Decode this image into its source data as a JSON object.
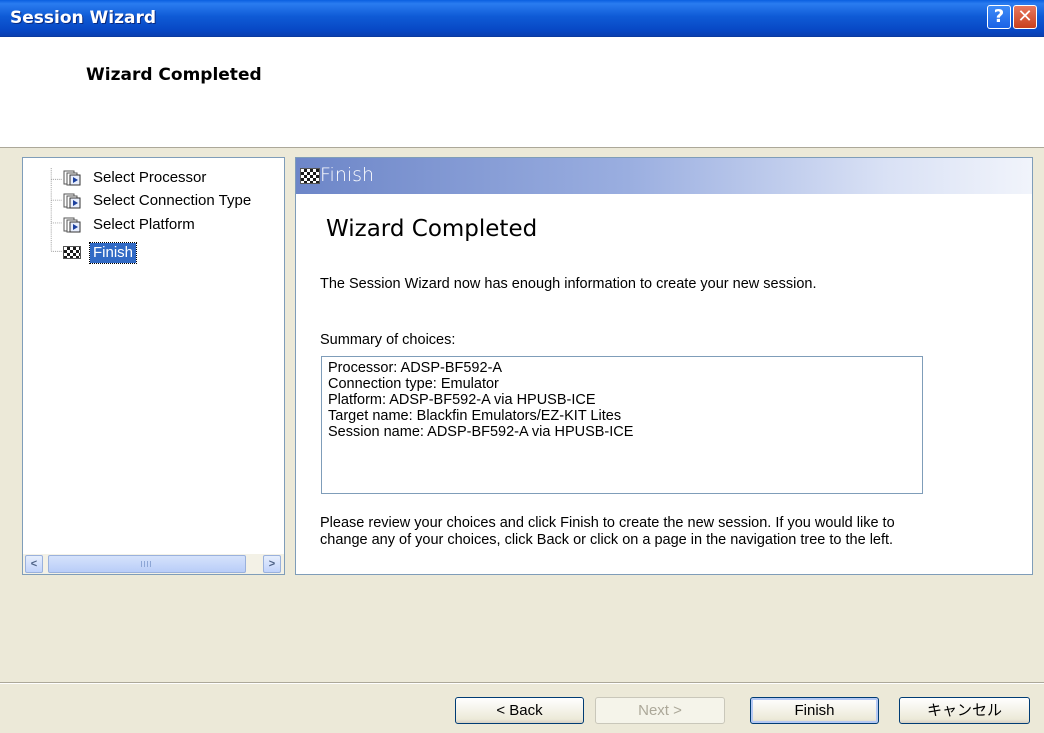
{
  "window": {
    "title": "Session Wizard",
    "help_glyph": "?",
    "close_glyph": "✕"
  },
  "header": {
    "title": "Wizard Completed"
  },
  "tree": {
    "items": [
      {
        "label": "Select Processor",
        "icon": "page-arrow-icon"
      },
      {
        "label": "Select Connection Type",
        "icon": "page-arrow-icon"
      },
      {
        "label": "Select Platform",
        "icon": "page-arrow-icon"
      },
      {
        "label": "Finish",
        "icon": "checkered-flag-icon",
        "selected": true
      }
    ],
    "scroll_left": "<",
    "scroll_right": ">"
  },
  "content": {
    "heading": "Finish",
    "title": "Wizard Completed",
    "intro": "The Session Wizard now has enough information to create your new session.",
    "summary_label": "Summary of choices:",
    "summary_lines": [
      "Processor: ADSP-BF592-A",
      "Connection type: Emulator",
      "Platform: ADSP-BF592-A via HPUSB-ICE",
      "Target name: Blackfin Emulators/EZ-KIT Lites",
      "Session name: ADSP-BF592-A via HPUSB-ICE"
    ],
    "footer": "Please review your choices and click Finish to create the new session.  If you would like to change any of your choices, click Back or click on a page in the navigation tree to the left."
  },
  "buttons": {
    "back": "< Back",
    "next": "Next >",
    "finish": "Finish",
    "cancel": "キャンセル"
  },
  "colors": {
    "titlebar": "#0a5fe0",
    "selection": "#316ac5",
    "dialog_bg": "#ece9d8"
  }
}
